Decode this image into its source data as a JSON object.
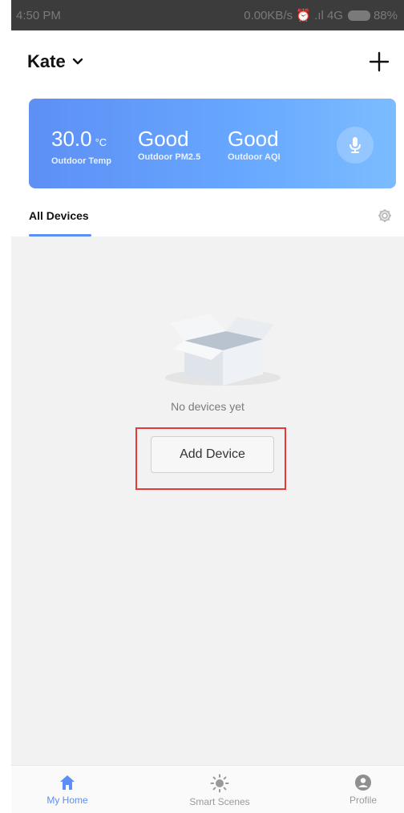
{
  "status_bar": {
    "time": "4:50 PM",
    "network": "0.00KB/s ⏰ .ıl 4G",
    "battery": "88%"
  },
  "header": {
    "home_name": "Kate",
    "add_icon": "plus-icon"
  },
  "weather": {
    "temp_value": "30.0",
    "temp_unit": "°C",
    "temp_label": "Outdoor Temp",
    "pm25_value": "Good",
    "pm25_label": "Outdoor PM2.5",
    "aqi_value": "Good",
    "aqi_label": "Outdoor AQI",
    "mic_icon": "microphone-icon",
    "gradient_start": "#5e8ff4",
    "gradient_end": "#7bbcff"
  },
  "tabs": {
    "all_devices": "All Devices",
    "settings_icon": "gear-icon",
    "accent": "#5c8ff5"
  },
  "empty_state": {
    "message": "No devices yet",
    "add_button": "Add Device"
  },
  "bottom_nav": {
    "items": [
      {
        "label": "My Home",
        "icon": "home-icon",
        "active": true
      },
      {
        "label": "Smart Scenes",
        "icon": "sun-icon",
        "active": false
      },
      {
        "label": "Profile",
        "icon": "user-icon",
        "active": false
      }
    ]
  }
}
